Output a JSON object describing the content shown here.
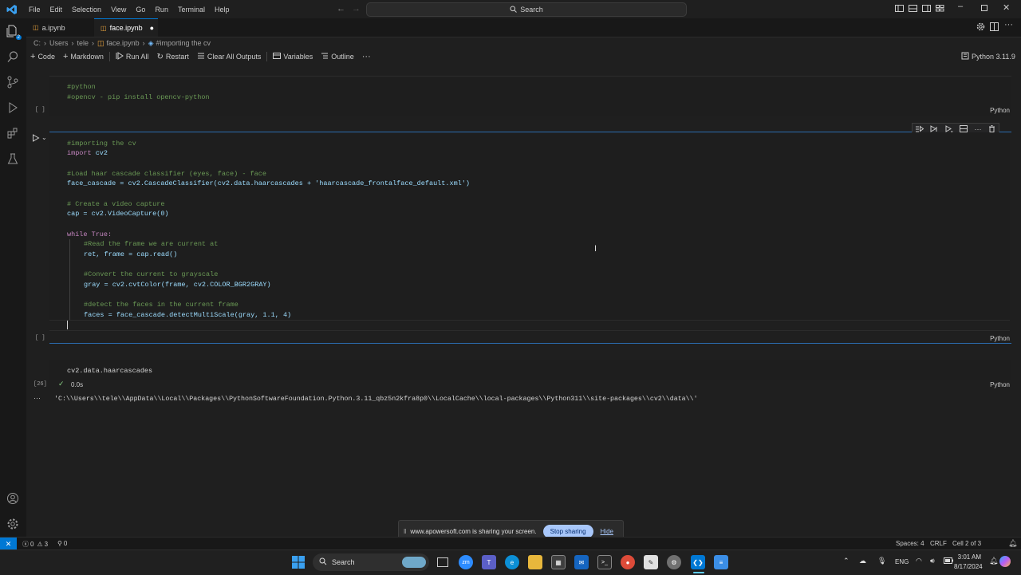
{
  "menu": [
    "File",
    "Edit",
    "Selection",
    "View",
    "Go",
    "Run",
    "Terminal",
    "Help"
  ],
  "search": {
    "label": "Search"
  },
  "tabs": [
    {
      "label": "a.ipynb",
      "active": false
    },
    {
      "label": "face.ipynb",
      "active": true,
      "modified": true
    }
  ],
  "breadcrumb": [
    "C:",
    "Users",
    "tele",
    "face.ipynb",
    "#importing the cv"
  ],
  "toolbar": {
    "code": "Code",
    "markdown": "Markdown",
    "run_all": "Run All",
    "restart": "Restart",
    "clear": "Clear All Outputs",
    "variables": "Variables",
    "outline": "Outline",
    "kernel": "Python 3.11.9"
  },
  "cells": {
    "cell1": {
      "lines": [
        "#python",
        "#opencv - pip install opencv-python"
      ],
      "bracket": "[ ]",
      "lang": "Python"
    },
    "cell2": {
      "bracket": "[ ]",
      "lang": "Python",
      "lines": {
        "l1": "#importing the cv",
        "l2a": "import",
        "l2b": " cv2",
        "l4": "#Load haar cascade classifier (eyes, face) - face",
        "l5": "face_cascade = cv2.CascadeClassifier(cv2.data.haarcascades + 'haarcascade_frontalface_default.xml')",
        "l7": "# Create a video capture",
        "l8": "cap = cv2.VideoCapture(0)",
        "l10": "while True:",
        "l11": "#Read the frame we are current at",
        "l12": "ret, frame = cap.read()",
        "l14": "#Convert the current to grayscale",
        "l15": "gray = cv2.cvtColor(frame, cv2.COLOR_BGR2GRAY)",
        "l17": "#detect the faces in the current frame",
        "l18": "faces = face_cascade.detectMultiScale(gray, 1.1, 4)"
      }
    },
    "cell3": {
      "code": "cv2.data.haarcascades",
      "bracket": "[26]",
      "timing": "0.0s",
      "lang": "Python",
      "output": "'C:\\\\Users\\\\tele\\\\AppData\\\\Local\\\\Packages\\\\PythonSoftwareFoundation.Python.3.11_qbz5n2kfra8p0\\\\LocalCache\\\\local-packages\\\\Python311\\\\site-packages\\\\cv2\\\\data\\\\'"
    }
  },
  "status": {
    "errors": "0",
    "warnings": "3",
    "ports": "0",
    "spaces": "Spaces: 4",
    "eol": "CRLF",
    "cell": "Cell 2 of 3"
  },
  "share": {
    "text": "www.apowersoft.com is sharing your screen.",
    "stop": "Stop sharing",
    "hide": "Hide"
  },
  "taskbar": {
    "search": "Search",
    "lang": "ENG",
    "time": "3:01 AM",
    "date": "8/17/2024"
  },
  "colors": {
    "accent": "#0078d4",
    "stop_btn": "#a8c7fa"
  }
}
